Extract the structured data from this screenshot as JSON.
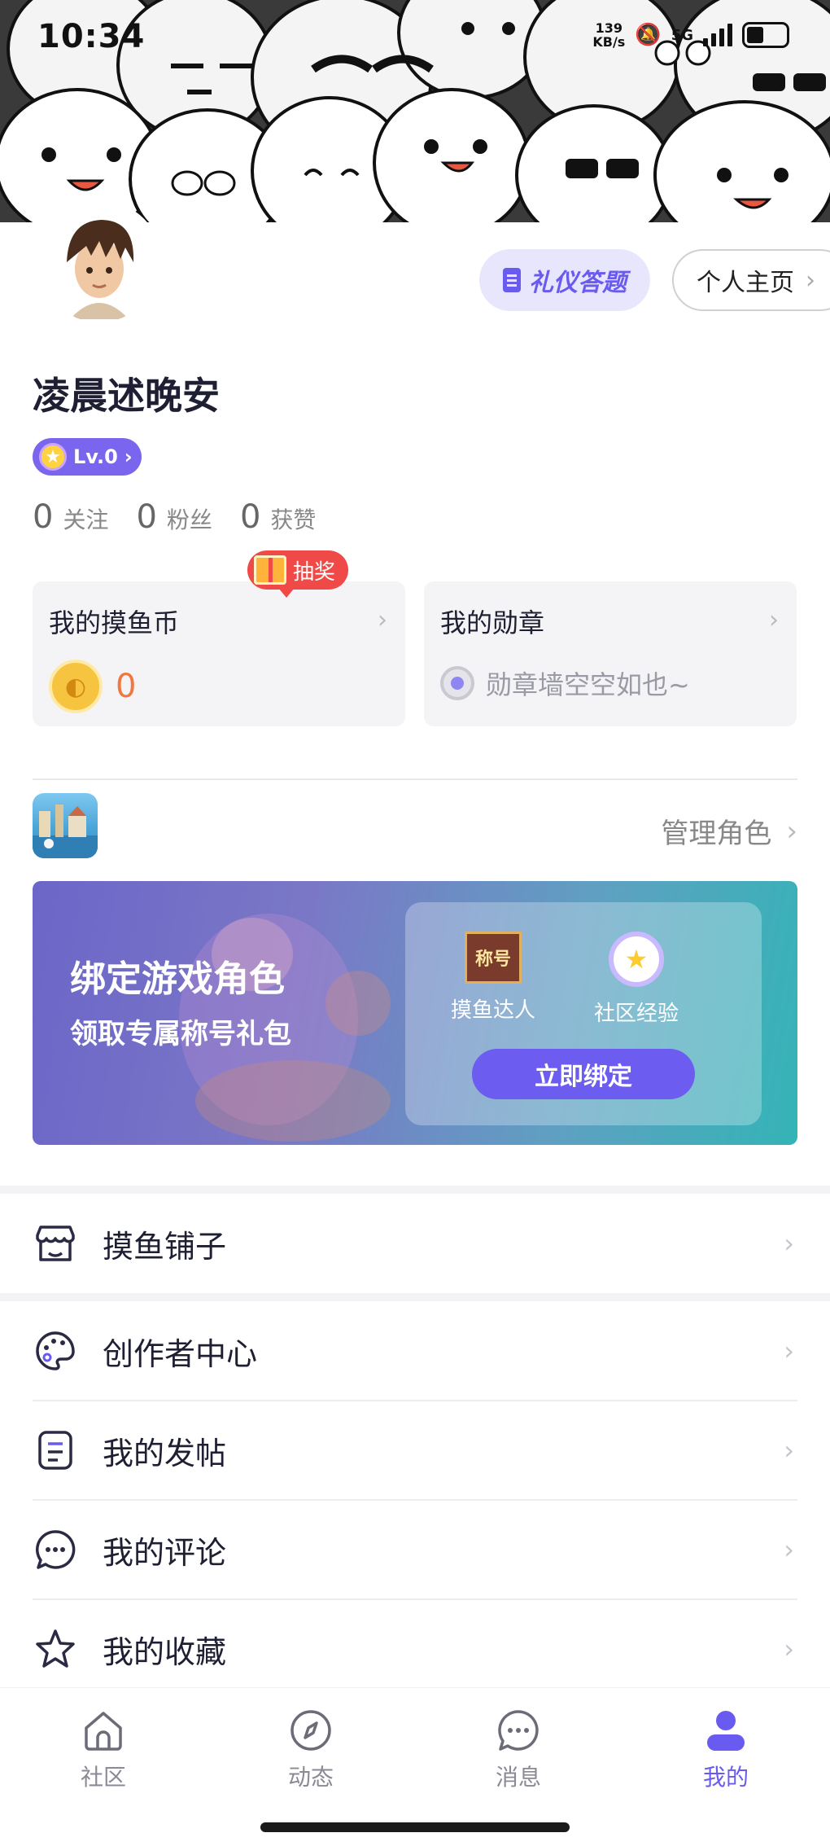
{
  "status_bar": {
    "time": "10:34",
    "net_speed_value": "139",
    "net_speed_unit": "KB/s",
    "network": "5G",
    "battery_icon": "battery-icon",
    "mute_icon": "mute-icon"
  },
  "profile": {
    "quiz_button": "礼仪答题",
    "home_button": "个人主页",
    "username": "凌晨述晚安",
    "level": "Lv.0",
    "stats": [
      {
        "value": "0",
        "label": "关注"
      },
      {
        "value": "0",
        "label": "粉丝"
      },
      {
        "value": "0",
        "label": "获赞"
      }
    ]
  },
  "cards": {
    "coins": {
      "title": "我的摸鱼币",
      "value": "0",
      "lottery_tag": "抽奖"
    },
    "medals": {
      "title": "我的勋章",
      "empty_text": "勋章墙空空如也~"
    }
  },
  "game": {
    "manage_role": "管理角色",
    "bind_title": "绑定游戏角色",
    "bind_subtitle": "领取专属称号礼包",
    "rewards": [
      {
        "icon_text": "称号",
        "label": "摸鱼达人"
      },
      {
        "icon_text": "★",
        "label": "社区经验"
      }
    ],
    "bind_button": "立即绑定"
  },
  "menu": [
    {
      "label": "摸鱼铺子",
      "icon": "shop-icon"
    },
    {
      "label": "创作者中心",
      "icon": "palette-icon"
    },
    {
      "label": "我的发帖",
      "icon": "document-icon"
    },
    {
      "label": "我的评论",
      "icon": "comment-icon"
    },
    {
      "label": "我的收藏",
      "icon": "star-icon"
    }
  ],
  "tabs": [
    {
      "label": "社区",
      "icon": "home-icon"
    },
    {
      "label": "动态",
      "icon": "compass-icon"
    },
    {
      "label": "消息",
      "icon": "message-icon"
    },
    {
      "label": "我的",
      "icon": "user-icon",
      "active": true
    }
  ],
  "colors": {
    "accent": "#6a5bf0",
    "coin_value": "#f07740",
    "lottery": "#f04a48"
  }
}
